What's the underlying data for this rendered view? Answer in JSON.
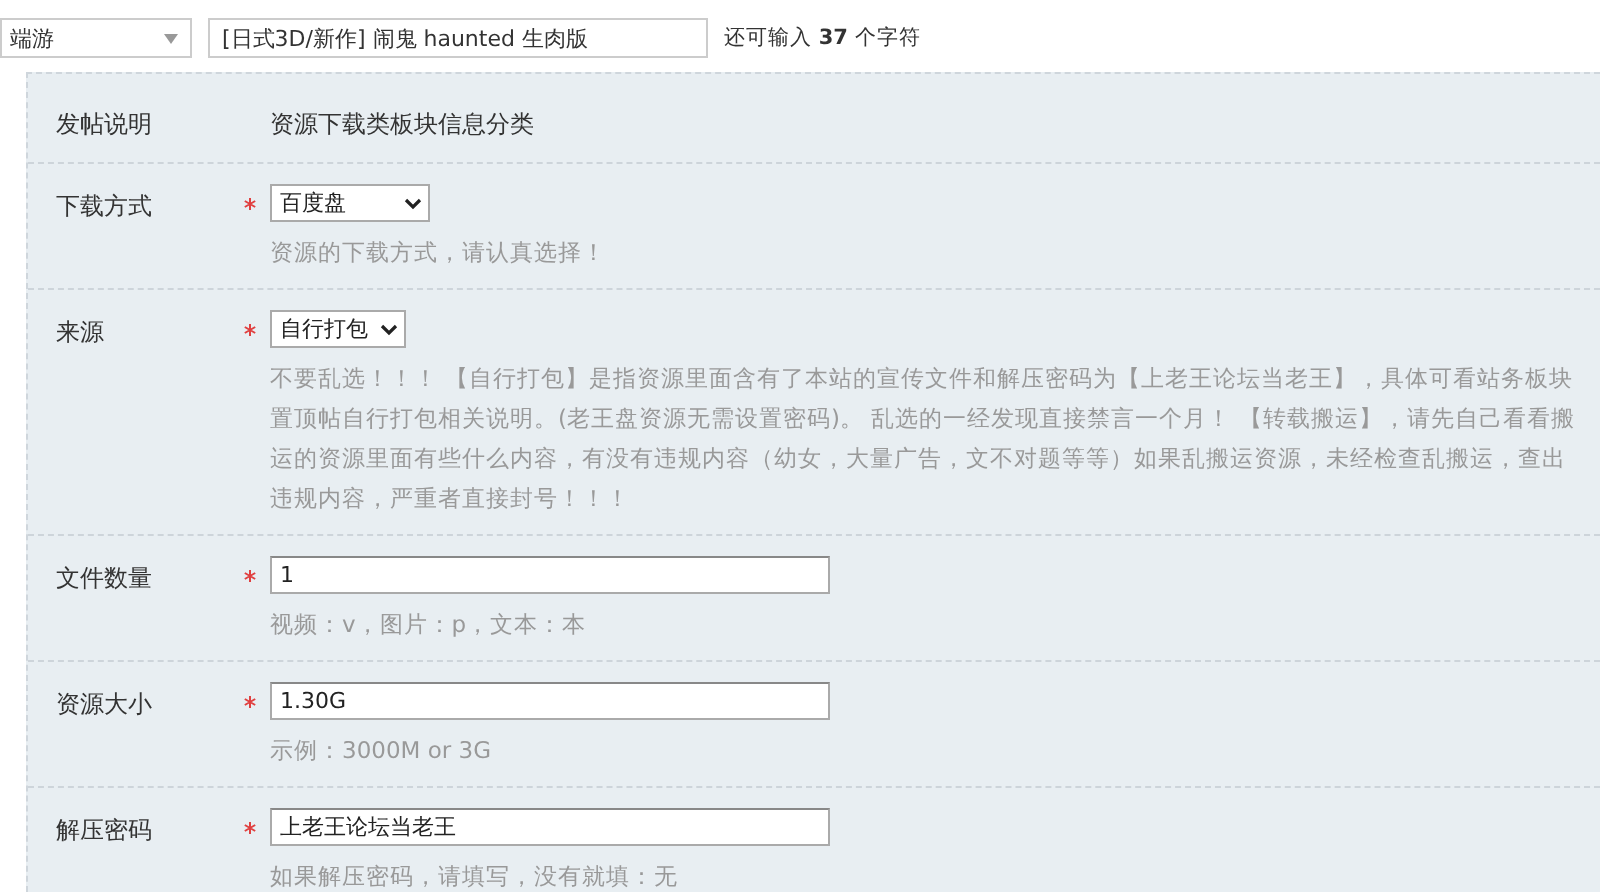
{
  "header": {
    "category": {
      "value": "端游"
    },
    "title": {
      "value": "[日式3D/新作] 闹鬼 haunted 生肉版"
    },
    "counter": {
      "prefix": "还可输入",
      "count": "37",
      "suffix": "个字符"
    }
  },
  "form": {
    "rows": [
      {
        "kind": "note",
        "label": "发帖说明",
        "text": "资源下载类板块信息分类"
      },
      {
        "kind": "select",
        "label": "下载方式",
        "required": true,
        "value": "百度盘",
        "wide": true,
        "hint": [
          "资源的下载方式，请认真选择！"
        ]
      },
      {
        "kind": "select",
        "label": "来源",
        "required": true,
        "value": "自行打包",
        "wide": false,
        "hint": [
          "不要乱选！！！ 【自行打包】是指资源里面含有了本站的宣传文件和解压密码为【上老王论坛当老王】，具体可看站务板块",
          "置顶帖自行打包相关说明。(老王盘资源无需设置密码)。 乱选的一经发现直接禁言一个月！ 【转载搬运】，请先自己看看搬",
          "运的资源里面有些什么内容，有没有违规内容（幼女，大量广告，文不对题等等）如果乱搬运资源，未经检查乱搬运，查出",
          "违规内容，严重者直接封号！！！"
        ]
      },
      {
        "kind": "text",
        "label": "文件数量",
        "required": true,
        "value": "1",
        "hint": [
          "视频：v，图片：p，文本：本"
        ]
      },
      {
        "kind": "text",
        "label": "资源大小",
        "required": true,
        "value": "1.30G",
        "hint": [
          "示例：3000M or 3G"
        ]
      },
      {
        "kind": "text",
        "label": "解压密码",
        "required": true,
        "value": "上老王论坛当老王",
        "hint": [
          "如果解压密码，请填写，没有就填：无"
        ]
      }
    ]
  }
}
